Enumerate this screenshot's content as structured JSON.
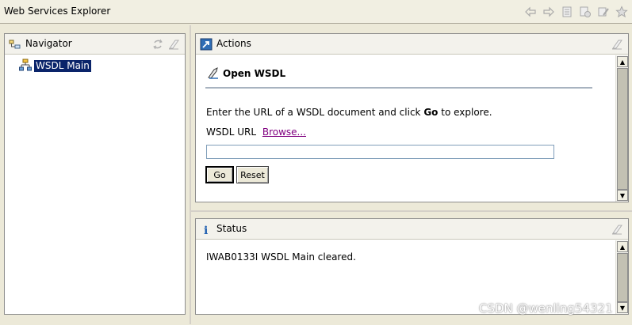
{
  "window": {
    "title": "Web Services Explorer"
  },
  "toolbar": {
    "icons": [
      "back-icon",
      "forward-icon",
      "page-icon",
      "page-refresh-icon",
      "clear-icon",
      "favorites-star-icon"
    ]
  },
  "navigator": {
    "title": "Navigator",
    "items": [
      {
        "label": "WSDL Main",
        "selected": true
      }
    ]
  },
  "actions": {
    "title": "Actions",
    "section_title": "Open WSDL",
    "intro_prefix": "Enter the URL of a WSDL document and click",
    "intro_bold": "Go",
    "intro_suffix": "to explore.",
    "url_label": "WSDL URL",
    "browse_link": "Browse...",
    "url_value": "",
    "go_label": "Go",
    "reset_label": "Reset"
  },
  "status": {
    "title": "Status",
    "message": "IWAB0133I WSDL Main cleared."
  },
  "watermark": "CSDN @wenling54321",
  "colors": {
    "selection": "#0a246a",
    "link_visited": "#800080",
    "chrome": "#ece9d8"
  }
}
